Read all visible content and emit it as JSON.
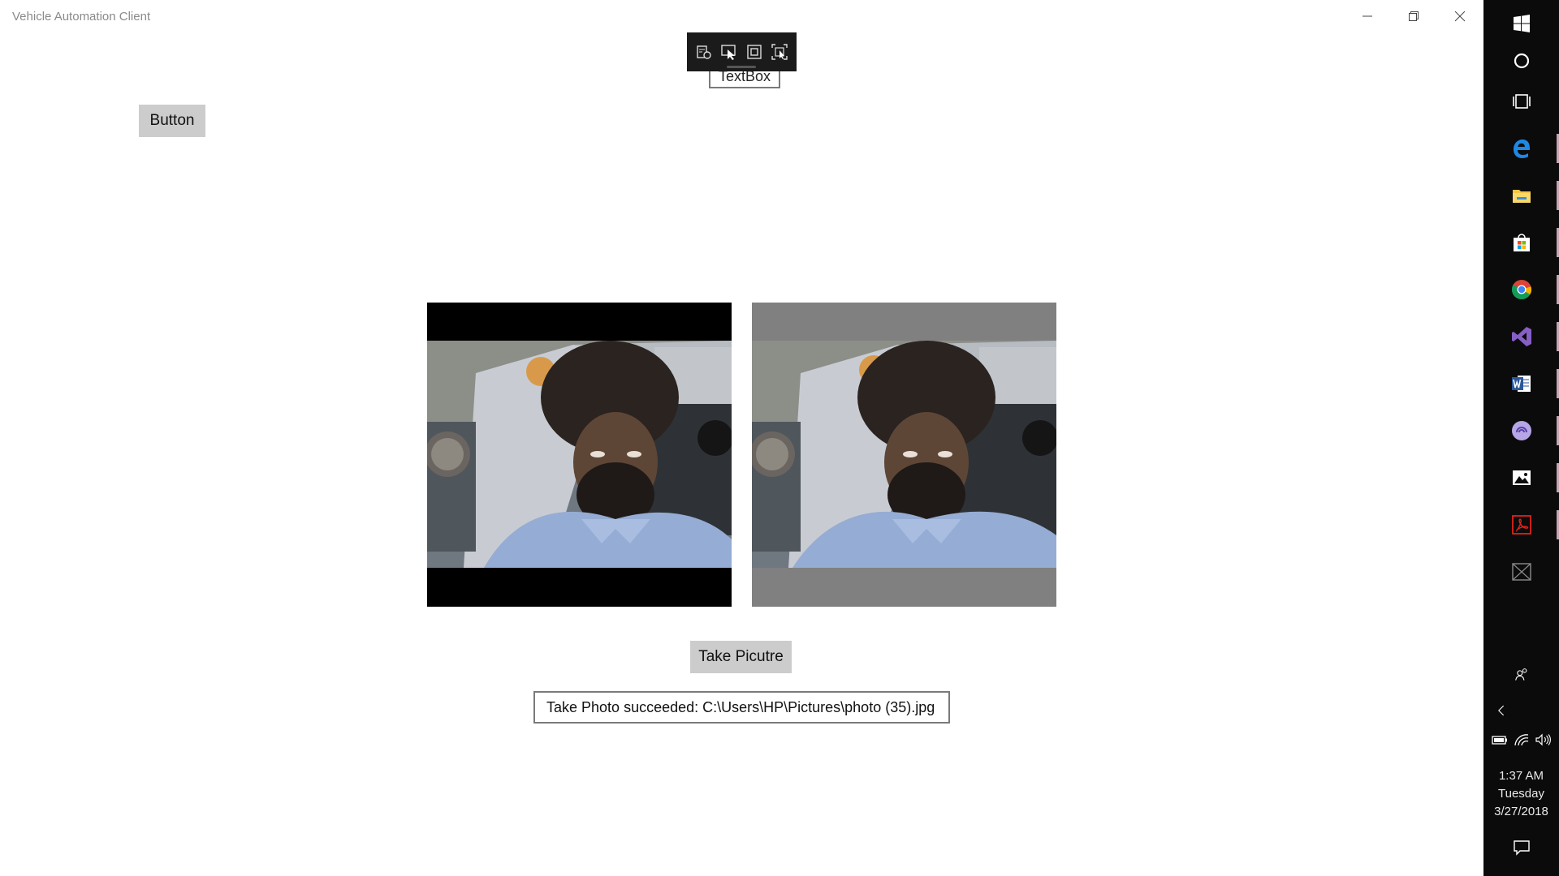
{
  "window": {
    "title": "Vehicle Automation Client"
  },
  "debug_toolbar": {
    "tools": [
      "live-visual-tree-icon",
      "select-element-icon",
      "display-layout-adorners-icon",
      "track-focused-element-icon"
    ]
  },
  "main": {
    "textbox_text": "TextBox",
    "top_button_label": "Button",
    "take_picture_label": "Take Picutre",
    "status_text": "Take Photo succeeded: C:\\Users\\HP\\Pictures\\photo (35).jpg"
  },
  "taskbar": {
    "pinned": [
      {
        "name": "start-icon",
        "running": false
      },
      {
        "name": "cortana-icon",
        "running": false
      },
      {
        "name": "task-view-icon",
        "running": false
      },
      {
        "name": "edge-icon",
        "running": true
      },
      {
        "name": "file-explorer-icon",
        "running": true
      },
      {
        "name": "store-icon",
        "running": true
      },
      {
        "name": "chrome-icon",
        "running": true
      },
      {
        "name": "visual-studio-icon",
        "running": true
      },
      {
        "name": "word-icon",
        "running": true
      },
      {
        "name": "bittorrent-icon",
        "running": true
      },
      {
        "name": "photos-icon",
        "running": true
      },
      {
        "name": "acrobat-icon",
        "running": true
      },
      {
        "name": "app-placeholder-icon",
        "running": false
      }
    ],
    "clock": {
      "time": "1:37 AM",
      "day": "Tuesday",
      "date": "3/27/2018"
    },
    "colors": {
      "background": "#0b0b0c",
      "running_indicator": "#c7a6b0"
    }
  }
}
